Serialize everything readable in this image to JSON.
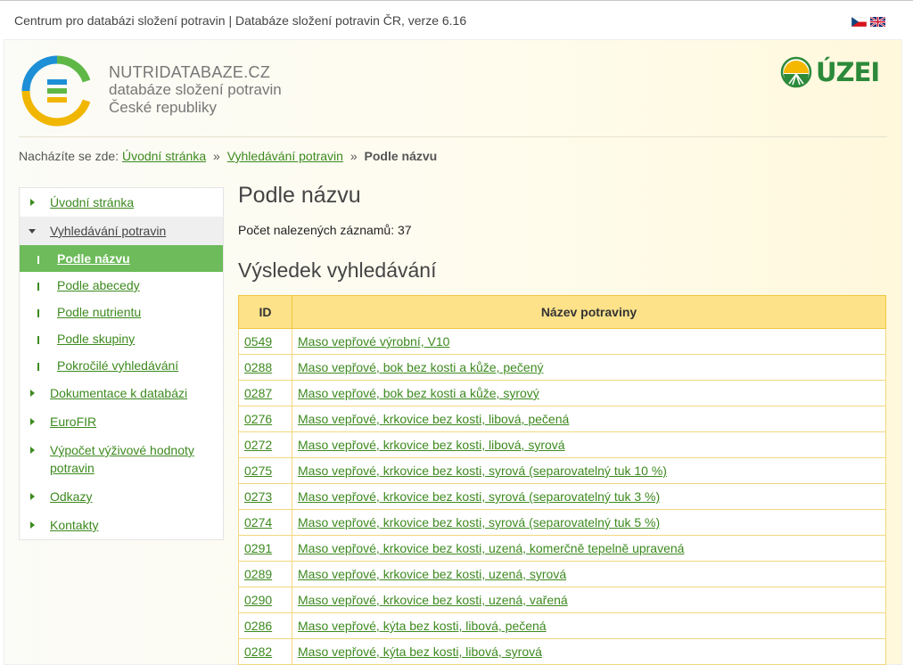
{
  "topbar": {
    "title": "Centrum pro databázi složení potravin | Databáze složení potravin ČR, verze 6.16"
  },
  "brand": {
    "name": "NUTRIDATABAZE.CZ",
    "line2": "databáze složení potravin",
    "line3": "České republiky",
    "partner_logo_text": "ÚZEI"
  },
  "breadcrumb": {
    "prefix": "Nacházíte se zde:",
    "items": [
      "Úvodní stránka",
      "Vyhledávání potravin"
    ],
    "separator": "»",
    "current": "Podle názvu"
  },
  "sidebar": {
    "items": [
      {
        "label": "Úvodní stránka"
      },
      {
        "label": "Vyhledávání potravin"
      },
      {
        "label": "Dokumentace k databázi"
      },
      {
        "label": "EuroFIR"
      },
      {
        "label": "Výpočet výživové hodnoty potravin"
      },
      {
        "label": "Odkazy"
      },
      {
        "label": "Kontakty"
      }
    ],
    "sub_items": [
      {
        "label": "Podle názvu"
      },
      {
        "label": "Podle abecedy"
      },
      {
        "label": "Podle nutrientu"
      },
      {
        "label": "Podle skupiny"
      },
      {
        "label": "Pokročilé vyhledávání"
      }
    ]
  },
  "main": {
    "title": "Podle názvu",
    "count_label": "Počet nalezených záznamů: 37",
    "results_title": "Výsledek vyhledávání",
    "table": {
      "headers": [
        "ID",
        "Název potraviny"
      ],
      "rows": [
        {
          "id": "0549",
          "name": "Maso vepřové výrobní, V10"
        },
        {
          "id": "0288",
          "name": "Maso vepřové, bok bez kosti a kůže, pečený"
        },
        {
          "id": "0287",
          "name": "Maso vepřové, bok bez kosti a kůže, syrový"
        },
        {
          "id": "0276",
          "name": "Maso vepřové, krkovice bez kosti, libová, pečená"
        },
        {
          "id": "0272",
          "name": "Maso vepřové, krkovice bez kosti, libová, syrová"
        },
        {
          "id": "0275",
          "name": "Maso vepřové, krkovice bez kosti, syrová (separovatelný tuk 10 %)"
        },
        {
          "id": "0273",
          "name": "Maso vepřové, krkovice bez kosti, syrová (separovatelný tuk 3 %)"
        },
        {
          "id": "0274",
          "name": "Maso vepřové, krkovice bez kosti, syrová (separovatelný tuk 5 %)"
        },
        {
          "id": "0291",
          "name": "Maso vepřové, krkovice bez kosti, uzená, komerčně tepelně upravená"
        },
        {
          "id": "0289",
          "name": "Maso vepřové, krkovice bez kosti, uzená, syrová"
        },
        {
          "id": "0290",
          "name": "Maso vepřové, krkovice bez kosti, uzená, vařená"
        },
        {
          "id": "0286",
          "name": "Maso vepřové, kýta bez kosti, libová, pečená"
        },
        {
          "id": "0282",
          "name": "Maso vepřové, kýta bez kosti, libová, syrová"
        }
      ]
    }
  },
  "colors": {
    "link": "#3d8a1f",
    "active_nav": "#6dbb5a",
    "table_header": "#fde28a",
    "table_border": "#f0c742"
  }
}
